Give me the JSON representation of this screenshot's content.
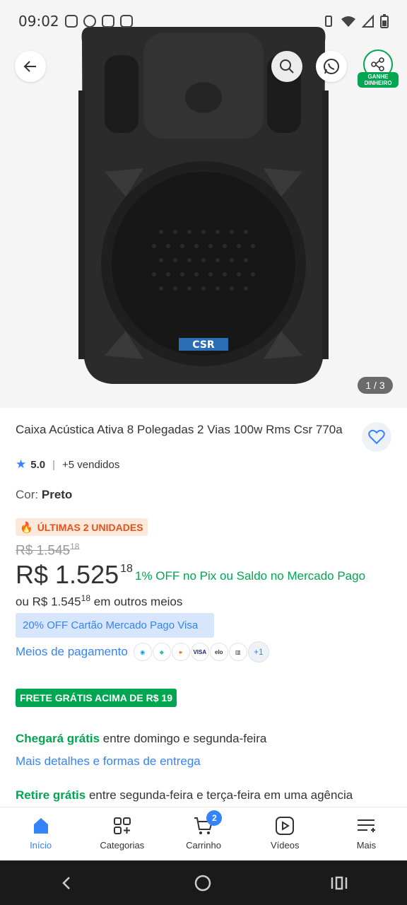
{
  "status_bar": {
    "time": "09:02"
  },
  "gallery": {
    "counter": "1 / 3",
    "share_badge": "GANHE DINHEIRO",
    "speaker_logo": "CSR"
  },
  "product": {
    "title": "Caixa Acústica Ativa 8 Polegadas 2 Vias 100w Rms Csr 770a",
    "rating": "5.0",
    "sold": "+5 vendidos",
    "color_label": "Cor:",
    "color_value": "Preto",
    "stock_badge": "ÚLTIMAS 2 UNIDADES",
    "old_price": "R$ 1.545",
    "old_price_cents": "18",
    "price": "R$ 1.525",
    "price_cents": "18",
    "pix_off": "1% OFF",
    "pix_text": "no Pix ou Saldo no Mercado Pago",
    "alt_price_prefix": "ou R$ 1.545",
    "alt_price_cents": "18",
    "alt_price_suffix": "em outros meios",
    "card_promo": "20% OFF Cartão Mercado Pago Visa",
    "payment_label": "Meios de pagamento",
    "payment_icons": [
      "mercado-pago",
      "pix",
      "mastercard",
      "VISA",
      "elo",
      "boleto"
    ],
    "payment_more": "+1",
    "free_shipping": "FRETE GRÁTIS ACIMA DE R$ 19",
    "arrive_green": "Chegará grátis",
    "arrive_text": "entre domingo e segunda-feira",
    "more_details": "Mais detalhes e formas de entrega",
    "pickup_green": "Retire grátis",
    "pickup_text": "entre segunda-feira e terça-feira em uma agência"
  },
  "bottom_nav": {
    "items": [
      {
        "label": "Início",
        "icon": "home-icon"
      },
      {
        "label": "Categorias",
        "icon": "categories-icon"
      },
      {
        "label": "Carrinho",
        "icon": "cart-icon",
        "badge": "2"
      },
      {
        "label": "Vídeos",
        "icon": "video-icon"
      },
      {
        "label": "Mais",
        "icon": "more-icon"
      }
    ]
  },
  "colors": {
    "accent": "#3483fa",
    "green": "#00a650",
    "orange": "#e0541b"
  }
}
